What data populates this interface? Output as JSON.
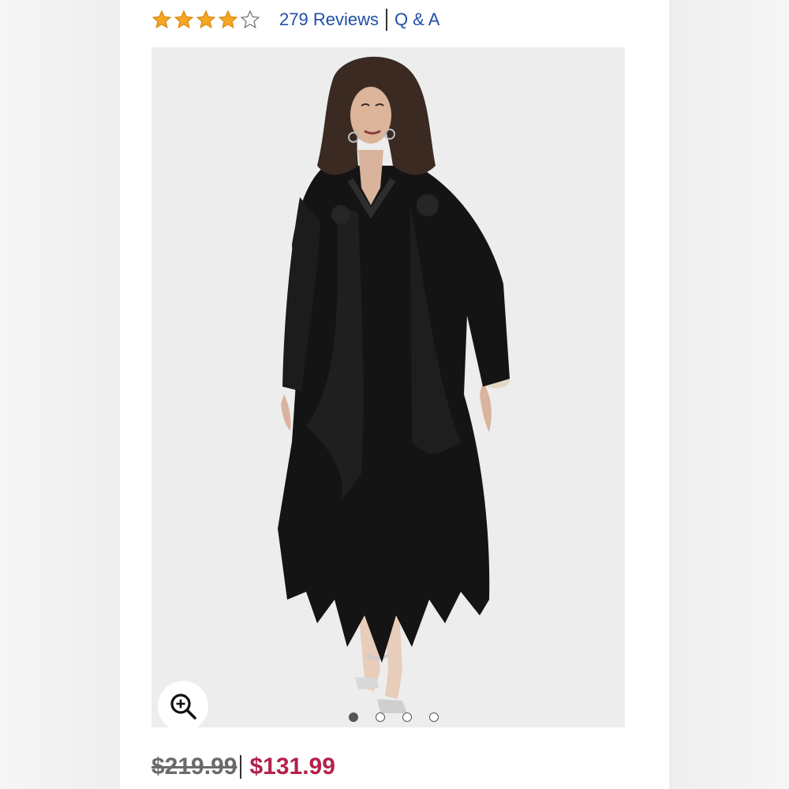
{
  "rating": {
    "value": 4,
    "max": 5,
    "star_color": "#f5a623",
    "icons": [
      "star-filled-icon",
      "star-filled-icon",
      "star-filled-icon",
      "star-filled-icon",
      "star-outline-icon"
    ]
  },
  "reviews_link": "279 Reviews",
  "qa_link": "Q & A",
  "gallery": {
    "image_index": 1,
    "image_count": 4,
    "zoom_icon": "zoom-in-icon"
  },
  "price": {
    "original": "$219.99",
    "sale": "$131.99",
    "sale_color": "#b3214b"
  },
  "colors": {
    "link": "#1f4fa8",
    "dress": "#111111",
    "background": "#ededed"
  }
}
